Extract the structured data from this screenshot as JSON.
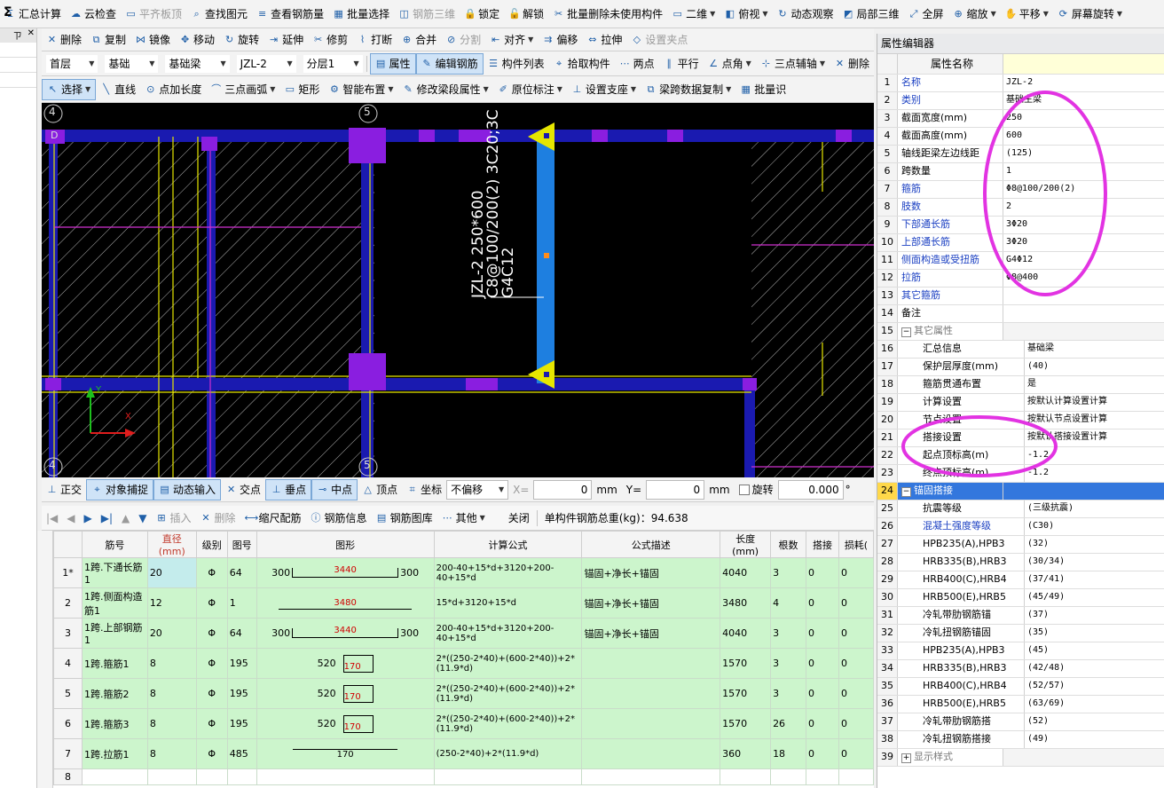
{
  "toolbar1": {
    "items": [
      "汇总计算",
      "云检查",
      "平齐板顶",
      "查找图元",
      "查看钢筋量",
      "批量选择",
      "钢筋三维",
      "锁定",
      "解锁",
      "批量删除未使用构件",
      "二维",
      "俯视",
      "动态观察",
      "局部三维",
      "全屏",
      "缩放",
      "平移",
      "屏幕旋转"
    ]
  },
  "toolbar2": {
    "items": [
      "删除",
      "复制",
      "镜像",
      "移动",
      "旋转",
      "延伸",
      "修剪",
      "打断",
      "合并",
      "分割",
      "对齐",
      "偏移",
      "拉伸",
      "设置夹点"
    ]
  },
  "toolbar3": {
    "floor": "首层",
    "category": "基础",
    "type": "基础梁",
    "member": "JZL-2",
    "layer": "分层1",
    "items": [
      "属性",
      "编辑钢筋",
      "构件列表",
      "拾取构件",
      "两点",
      "平行",
      "点角",
      "三点辅轴",
      "删除"
    ]
  },
  "toolbar4": {
    "items": [
      "选择",
      "直线",
      "点加长度",
      "三点画弧",
      "矩形",
      "智能布置",
      "修改梁段属性",
      "原位标注",
      "设置支座",
      "梁跨数据复制",
      "批量识"
    ]
  },
  "side_panel": {
    "pin": "ㄗ",
    "close": "✕"
  },
  "canvas": {
    "axis_labels": [
      "4",
      "5",
      "4",
      "5",
      "D"
    ],
    "beam_annotation": [
      "JZL-2 250*600",
      "C8@100/200(2) 3C20;3C",
      "G4C12"
    ],
    "axis_x": "X",
    "axis_y": "Y"
  },
  "snapbar": {
    "items": [
      "正交",
      "对象捕捉",
      "动态输入",
      "交点",
      "垂点",
      "中点",
      "顶点",
      "坐标"
    ],
    "offset_mode": "不偏移",
    "x_label": "X=",
    "x_value": "0",
    "y_label": "Y=",
    "y_value": "0",
    "unit": "mm",
    "rotate_label": "旋转",
    "rotate_value": "0.000",
    "degree": "°"
  },
  "rebar_toolbar": {
    "items": [
      "插入",
      "删除",
      "缩尺配筋",
      "钢筋信息",
      "钢筋图库",
      "其他",
      "关闭"
    ],
    "total_weight": "单构件钢筋总重(kg)：94.638"
  },
  "rebar_table": {
    "headers": [
      "筋号",
      "直径(mm)",
      "级别",
      "图号",
      "图形",
      "计算公式",
      "公式描述",
      "长度(mm)",
      "根数",
      "搭接",
      "损耗("
    ],
    "rows": [
      {
        "no": "1*",
        "name": "1跨.下通长筋1",
        "dia": "20",
        "grade": "Φ",
        "fig": "64",
        "shape_left": "300",
        "shape_mid": "3440",
        "shape_right": "300",
        "formula": "200-40+15*d+3120+200-40+15*d",
        "desc": "锚固+净长+锚固",
        "len": "4040",
        "count": "3",
        "lap": "0",
        "loss": "0"
      },
      {
        "no": "2",
        "name": "1跨.侧面构造筋1",
        "dia": "12",
        "grade": "Φ",
        "fig": "1",
        "shape_left": "",
        "shape_mid": "3480",
        "shape_right": "",
        "formula": "15*d+3120+15*d",
        "desc": "锚固+净长+锚固",
        "len": "3480",
        "count": "4",
        "lap": "0",
        "loss": "0"
      },
      {
        "no": "3",
        "name": "1跨.上部钢筋1",
        "dia": "20",
        "grade": "Φ",
        "fig": "64",
        "shape_left": "300",
        "shape_mid": "3440",
        "shape_right": "300",
        "formula": "200-40+15*d+3120+200-40+15*d",
        "desc": "锚固+净长+锚固",
        "len": "4040",
        "count": "3",
        "lap": "0",
        "loss": "0"
      },
      {
        "no": "4",
        "name": "1跨.箍筋1",
        "dia": "8",
        "grade": "Φ",
        "fig": "195",
        "shape_left": "520",
        "shape_mid": "170",
        "shape_right": "",
        "formula": "2*((250-2*40)+(600-2*40))+2*(11.9*d)",
        "desc": "",
        "len": "1570",
        "count": "3",
        "lap": "0",
        "loss": "0"
      },
      {
        "no": "5",
        "name": "1跨.箍筋2",
        "dia": "8",
        "grade": "Φ",
        "fig": "195",
        "shape_left": "520",
        "shape_mid": "170",
        "shape_right": "",
        "formula": "2*((250-2*40)+(600-2*40))+2*(11.9*d)",
        "desc": "",
        "len": "1570",
        "count": "3",
        "lap": "0",
        "loss": "0"
      },
      {
        "no": "6",
        "name": "1跨.箍筋3",
        "dia": "8",
        "grade": "Φ",
        "fig": "195",
        "shape_left": "520",
        "shape_mid": "170",
        "shape_right": "",
        "formula": "2*((250-2*40)+(600-2*40))+2*(11.9*d)",
        "desc": "",
        "len": "1570",
        "count": "26",
        "lap": "0",
        "loss": "0"
      },
      {
        "no": "7",
        "name": "1跨.拉筋1",
        "dia": "8",
        "grade": "Φ",
        "fig": "485",
        "shape_left": "",
        "shape_mid": "170",
        "shape_right": "",
        "formula": "(250-2*40)+2*(11.9*d)",
        "desc": "",
        "len": "360",
        "count": "18",
        "lap": "0",
        "loss": "0"
      },
      {
        "no": "8",
        "name": "",
        "dia": "",
        "grade": "",
        "fig": "",
        "shape_left": "",
        "shape_mid": "",
        "shape_right": "",
        "formula": "",
        "desc": "",
        "len": "",
        "count": "",
        "lap": "",
        "loss": ""
      }
    ]
  },
  "property_editor": {
    "title": "属性编辑器",
    "col_header": "属性名称",
    "rows": [
      {
        "n": "1",
        "name": "名称",
        "val": "JZL-2",
        "blue": true,
        "indent": 0
      },
      {
        "n": "2",
        "name": "类别",
        "val": "基础主梁",
        "blue": true,
        "indent": 0
      },
      {
        "n": "3",
        "name": "截面宽度(mm)",
        "val": "250",
        "blue": false,
        "indent": 0
      },
      {
        "n": "4",
        "name": "截面高度(mm)",
        "val": "600",
        "blue": false,
        "indent": 0
      },
      {
        "n": "5",
        "name": "轴线距梁左边线距",
        "val": "(125)",
        "blue": false,
        "indent": 0
      },
      {
        "n": "6",
        "name": "跨数量",
        "val": "1",
        "blue": false,
        "indent": 0
      },
      {
        "n": "7",
        "name": "箍筋",
        "val": "Φ8@100/200(2)",
        "blue": true,
        "indent": 0
      },
      {
        "n": "8",
        "name": "肢数",
        "val": "2",
        "blue": true,
        "indent": 0
      },
      {
        "n": "9",
        "name": "下部通长筋",
        "val": "3Φ20",
        "blue": true,
        "indent": 0
      },
      {
        "n": "10",
        "name": "上部通长筋",
        "val": "3Φ20",
        "blue": true,
        "indent": 0
      },
      {
        "n": "11",
        "name": "侧面构造或受扭筋",
        "val": "G4Φ12",
        "blue": true,
        "indent": 0
      },
      {
        "n": "12",
        "name": "拉筋",
        "val": "Φ8@400",
        "blue": true,
        "indent": 0
      },
      {
        "n": "13",
        "name": "其它箍筋",
        "val": "",
        "blue": true,
        "indent": 0
      },
      {
        "n": "14",
        "name": "备注",
        "val": "",
        "blue": false,
        "indent": 0
      },
      {
        "n": "15",
        "name": "其它属性",
        "val": "",
        "blue": false,
        "indent": 0,
        "tree": "−",
        "gray": true
      },
      {
        "n": "16",
        "name": "汇总信息",
        "val": "基础梁",
        "blue": false,
        "indent": 1
      },
      {
        "n": "17",
        "name": "保护层厚度(mm)",
        "val": "(40)",
        "blue": false,
        "indent": 1
      },
      {
        "n": "18",
        "name": "箍筋贯通布置",
        "val": "是",
        "blue": false,
        "indent": 1
      },
      {
        "n": "19",
        "name": "计算设置",
        "val": "按默认计算设置计算",
        "blue": false,
        "indent": 1
      },
      {
        "n": "20",
        "name": "节点设置",
        "val": "按默认节点设置计算",
        "blue": false,
        "indent": 1
      },
      {
        "n": "21",
        "name": "搭接设置",
        "val": "按默认搭接设置计算",
        "blue": false,
        "indent": 1
      },
      {
        "n": "22",
        "name": "起点顶标高(m)",
        "val": "-1.2",
        "blue": false,
        "indent": 1
      },
      {
        "n": "23",
        "name": "终点顶标高(m)",
        "val": "-1.2",
        "blue": false,
        "indent": 1
      },
      {
        "n": "24",
        "name": "锚固搭接",
        "val": "",
        "blue": false,
        "indent": 0,
        "tree": "−",
        "selected": true
      },
      {
        "n": "25",
        "name": "抗震等级",
        "val": "(三级抗震)",
        "blue": false,
        "indent": 1
      },
      {
        "n": "26",
        "name": "混凝土强度等级",
        "val": "(C30)",
        "blue": true,
        "indent": 1
      },
      {
        "n": "27",
        "name": "HPB235(A),HPB3",
        "val": "(32)",
        "blue": false,
        "indent": 1
      },
      {
        "n": "28",
        "name": "HRB335(B),HRB3",
        "val": "(30/34)",
        "blue": false,
        "indent": 1
      },
      {
        "n": "29",
        "name": "HRB400(C),HRB4",
        "val": "(37/41)",
        "blue": false,
        "indent": 1
      },
      {
        "n": "30",
        "name": "HRB500(E),HRB5",
        "val": "(45/49)",
        "blue": false,
        "indent": 1
      },
      {
        "n": "31",
        "name": "冷轧带肋钢筋锚",
        "val": "(37)",
        "blue": false,
        "indent": 1
      },
      {
        "n": "32",
        "name": "冷轧扭钢筋锚固",
        "val": "(35)",
        "blue": false,
        "indent": 1
      },
      {
        "n": "33",
        "name": "HPB235(A),HPB3",
        "val": "(45)",
        "blue": false,
        "indent": 1
      },
      {
        "n": "34",
        "name": "HRB335(B),HRB3",
        "val": "(42/48)",
        "blue": false,
        "indent": 1
      },
      {
        "n": "35",
        "name": "HRB400(C),HRB4",
        "val": "(52/57)",
        "blue": false,
        "indent": 1
      },
      {
        "n": "36",
        "name": "HRB500(E),HRB5",
        "val": "(63/69)",
        "blue": false,
        "indent": 1
      },
      {
        "n": "37",
        "name": "冷轧带肋钢筋搭",
        "val": "(52)",
        "blue": false,
        "indent": 1
      },
      {
        "n": "38",
        "name": "冷轧扭钢筋搭接",
        "val": "(49)",
        "blue": false,
        "indent": 1
      },
      {
        "n": "39",
        "name": "显示样式",
        "val": "",
        "blue": false,
        "indent": 0,
        "tree": "+",
        "gray": true
      }
    ]
  },
  "colors": {
    "highlight_circle": "#e233e2",
    "canvas_bg": "#000000",
    "beam_blue": "#1e7fe0",
    "grid_blue": "#1a1ab0",
    "column_purple": "#8a1ee0",
    "row_green": "#ccf5cc"
  }
}
